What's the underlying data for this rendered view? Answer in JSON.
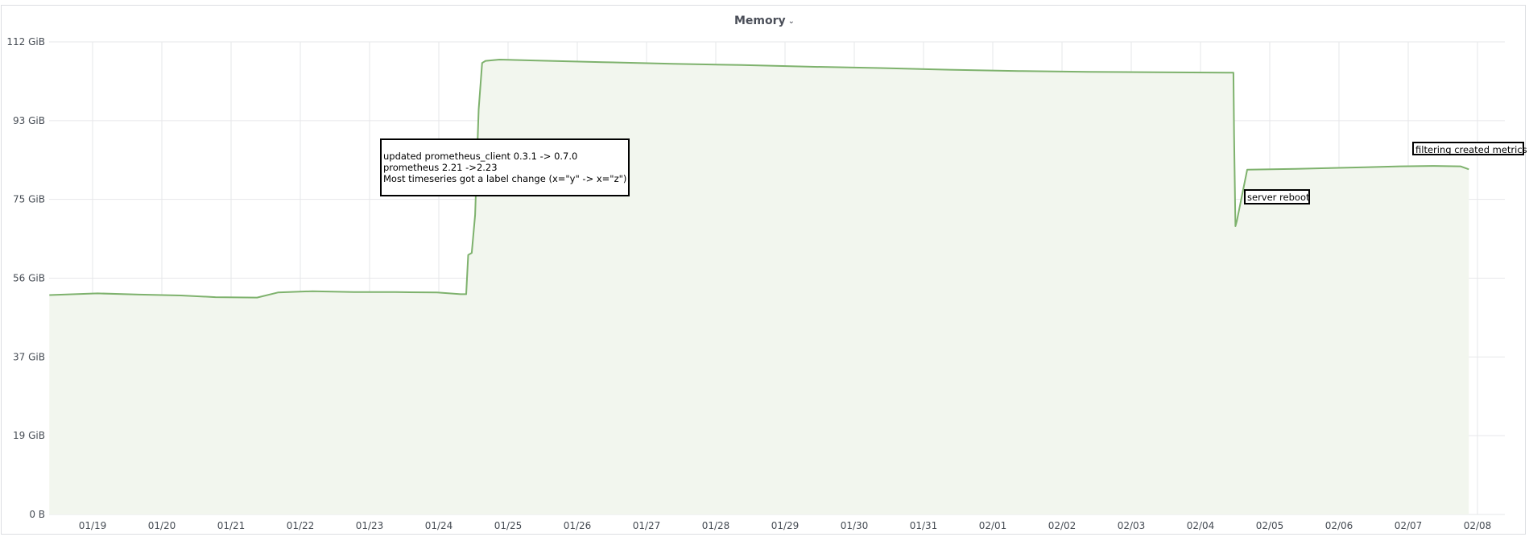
{
  "panel": {
    "title": "Memory",
    "dropdown_icon": "chevron-down-icon"
  },
  "colors": {
    "series_line": "#7eb26d",
    "series_fill": "#f2f6ee",
    "grid": "#e6e7ea",
    "annotation_border": "#000000"
  },
  "chart_data": {
    "type": "area",
    "title": "Memory",
    "xlabel": "",
    "ylabel": "",
    "grid": true,
    "legend": "none",
    "y_unit": "GiB",
    "ylim": [
      0,
      112
    ],
    "x_range": [
      "01/18 09:00",
      "02/08 12:00"
    ],
    "y_ticks": [
      {
        "value": 0,
        "label": "0 B"
      },
      {
        "value": 18.67,
        "label": "19 GiB"
      },
      {
        "value": 37.33,
        "label": "37 GiB"
      },
      {
        "value": 56,
        "label": "56 GiB"
      },
      {
        "value": 74.67,
        "label": "75 GiB"
      },
      {
        "value": 93.33,
        "label": "93 GiB"
      },
      {
        "value": 112,
        "label": "112 GiB"
      }
    ],
    "x_ticks": [
      "01/19",
      "01/20",
      "01/21",
      "01/22",
      "01/23",
      "01/24",
      "01/25",
      "01/26",
      "01/27",
      "01/28",
      "01/29",
      "01/30",
      "01/31",
      "02/01",
      "02/02",
      "02/03",
      "02/04",
      "02/05",
      "02/06",
      "02/07",
      "02/08"
    ],
    "series": [
      {
        "x": [
          0.0,
          0.7,
          1.3,
          1.9,
          2.4,
          3.0,
          3.3,
          3.8,
          4.4,
          5.0,
          5.6,
          5.94,
          6.02,
          6.05,
          6.1,
          6.15,
          6.2,
          6.25,
          6.3,
          6.5,
          7.0,
          8.0,
          9.0,
          10.0,
          11.0,
          12.0,
          13.0,
          14.0,
          15.0,
          16.0,
          17.0,
          17.1,
          17.11,
          17.13,
          17.15,
          17.3,
          18.0,
          19.0,
          19.5,
          20.0,
          20.38,
          20.5
        ],
        "y": [
          52.0,
          52.4,
          52.1,
          51.9,
          51.5,
          51.4,
          52.6,
          52.9,
          52.7,
          52.7,
          52.6,
          52.2,
          52.2,
          61.5,
          62.0,
          71.0,
          96.0,
          107.0,
          107.5,
          107.8,
          107.6,
          107.2,
          106.8,
          106.5,
          106.1,
          105.8,
          105.4,
          105.1,
          104.9,
          104.8,
          104.7,
          104.7,
          90.0,
          68.3,
          69.5,
          81.7,
          81.9,
          82.3,
          82.5,
          82.6,
          82.5,
          81.8
        ]
      }
    ],
    "annotations": [
      {
        "x": 6.3,
        "lines": [
          "updated prometheus_client 0.3.1 -> 0.7.0",
          "prometheus 2.21 ->2.23",
          "Most timeseries got a label change (x=\"y\" -> x=\"z\")"
        ]
      },
      {
        "x": 17.11,
        "lines": [
          "server reboot"
        ]
      },
      {
        "x": 20.3,
        "lines": [
          "filtering created metrics"
        ]
      }
    ]
  }
}
